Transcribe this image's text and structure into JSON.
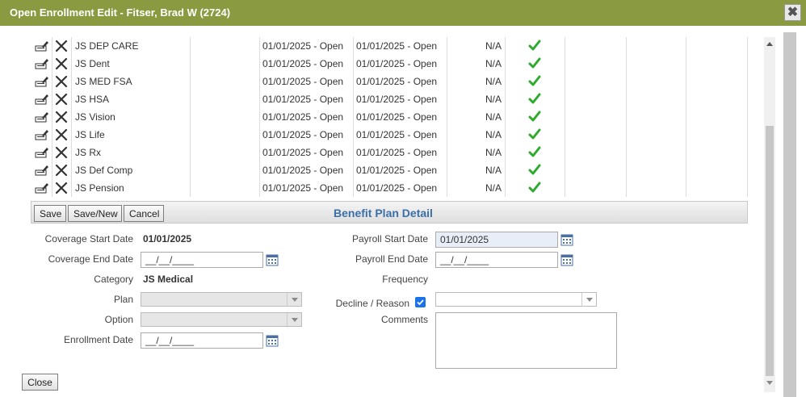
{
  "window": {
    "title": "Open Enrollment Edit - Fitser, Brad W (2724)",
    "close_glyph": "✖"
  },
  "plans": [
    {
      "name": "JS DEP CARE",
      "start": "01/01/2025 - Open",
      "end": "01/01/2025 - Open",
      "na": "N/A"
    },
    {
      "name": "JS Dent",
      "start": "01/01/2025 - Open",
      "end": "01/01/2025 - Open",
      "na": "N/A"
    },
    {
      "name": "JS MED FSA",
      "start": "01/01/2025 - Open",
      "end": "01/01/2025 - Open",
      "na": "N/A"
    },
    {
      "name": "JS HSA",
      "start": "01/01/2025 - Open",
      "end": "01/01/2025 - Open",
      "na": "N/A"
    },
    {
      "name": "JS Vision",
      "start": "01/01/2025 - Open",
      "end": "01/01/2025 - Open",
      "na": "N/A"
    },
    {
      "name": "JS Life",
      "start": "01/01/2025 - Open",
      "end": "01/01/2025 - Open",
      "na": "N/A"
    },
    {
      "name": "JS Rx",
      "start": "01/01/2025 - Open",
      "end": "01/01/2025 - Open",
      "na": "N/A"
    },
    {
      "name": "JS Def Comp",
      "start": "01/01/2025 - Open",
      "end": "01/01/2025 - Open",
      "na": "N/A"
    },
    {
      "name": "JS Pension",
      "start": "01/01/2025 - Open",
      "end": "01/01/2025 - Open",
      "na": "N/A"
    }
  ],
  "toolbar": {
    "save": "Save",
    "save_new": "Save/New",
    "cancel": "Cancel",
    "section_title": "Benefit Plan Detail"
  },
  "form": {
    "coverage_start_label": "Coverage Start Date",
    "coverage_start_value": "01/01/2025",
    "coverage_end_label": "Coverage End Date",
    "coverage_end_value": "__/__/____",
    "category_label": "Category",
    "category_value": "JS Medical",
    "plan_label": "Plan",
    "option_label": "Option",
    "enrollment_date_label": "Enrollment Date",
    "enrollment_date_value": "__/__/____",
    "payroll_start_label": "Payroll Start Date",
    "payroll_start_value": "01/01/2025",
    "payroll_end_label": "Payroll End Date",
    "payroll_end_value": "__/__/____",
    "frequency_label": "Frequency",
    "decline_label": "Decline / Reason",
    "decline_checked": true,
    "comments_label": "Comments"
  },
  "footer": {
    "close": "Close"
  },
  "colors": {
    "titlebar": "#8a9a40",
    "accent_blue": "#3a6fa8",
    "check_green": "#2eaa2e"
  }
}
